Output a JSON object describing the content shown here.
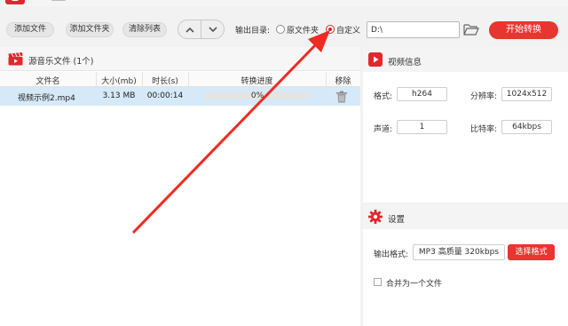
{
  "toolbar": {
    "add_file": "添加文件",
    "add_folder": "添加文件夹",
    "clear_list": "清除列表",
    "output_dir_label": "输出目录:",
    "radio_original": "原文件夹",
    "radio_custom": "自定义",
    "path_value": "D:\\",
    "start_button": "开始转换"
  },
  "file_list": {
    "title": "源音乐文件 (1个)",
    "columns": [
      "文件名",
      "大小(mb)",
      "时长(s)",
      "转换进度",
      "移除"
    ],
    "rows": [
      {
        "name": "视频示例2.mp4",
        "size": "3.13 MB",
        "duration": "00:00:14",
        "progress_text": "0%",
        "progress": 0
      }
    ]
  },
  "video_info": {
    "title": "视频信息",
    "format_label": "格式:",
    "format_value": "h264",
    "resolution_label": "分辨率:",
    "resolution_value": "1024x512",
    "channel_label": "声道:",
    "channel_value": "1",
    "bitrate_label": "比特率:",
    "bitrate_value": "64kbps"
  },
  "settings": {
    "title": "设置",
    "output_format_label": "输出格式:",
    "output_format_value": "MP3 高质量 320kbps",
    "select_format_button": "选择格式",
    "merge_label": "合并为一个文件"
  },
  "colors": {
    "accent": "#e8352f",
    "row_selected": "#d6e9f8"
  }
}
